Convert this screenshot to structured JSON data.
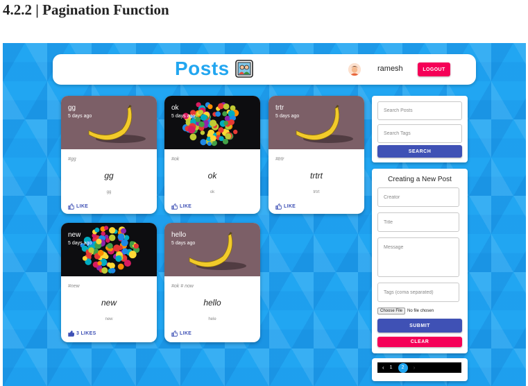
{
  "document": {
    "heading": "4.2.2 | Pagination Function"
  },
  "colors": {
    "brand": "#22a6f0",
    "primary": "#3f51b5",
    "secondary": "#f50057",
    "background": "#21a6f2"
  },
  "header": {
    "title": "Posts",
    "brand_icon": "memories-photo-icon",
    "user": {
      "avatar_icon": "user-avatar-icon",
      "name": "ramesh"
    },
    "logout_label": "LOGOUT"
  },
  "posts": [
    {
      "title": "gg",
      "date": "5 days ago",
      "tags": "#gg",
      "heading": "gg",
      "message": "gg",
      "likes": "LIKE",
      "image": "banana"
    },
    {
      "title": "ok",
      "date": "5 days ago",
      "tags": "#ok",
      "heading": "ok",
      "message": "ok",
      "likes": "LIKE",
      "image": "balls"
    },
    {
      "title": "trtr",
      "date": "5 days ago",
      "tags": "#trtr",
      "heading": "trtrt",
      "message": "trtrt",
      "likes": "LIKE",
      "image": "banana"
    },
    {
      "title": "new",
      "date": "5 days ago",
      "tags": "#new",
      "heading": "new",
      "message": "new",
      "likes": "3 LIKES",
      "image": "balls"
    },
    {
      "title": "hello",
      "date": "5 days ago",
      "tags": "#ok # now",
      "heading": "hello",
      "message": "hele",
      "likes": "LIKE",
      "image": "banana"
    }
  ],
  "search": {
    "posts_placeholder": "Search Posts",
    "tags_placeholder": "Search Tags",
    "button_label": "SEARCH"
  },
  "form": {
    "title": "Creating a New Post",
    "creator_placeholder": "Creator",
    "title_placeholder": "Title",
    "message_placeholder": "Message",
    "tags_placeholder": "Tags (coma separated)",
    "file_button": "Choose File",
    "file_status": "No file chosen",
    "submit_label": "SUBMIT",
    "clear_label": "CLEAR"
  },
  "pagination": {
    "prev": "‹",
    "pages": [
      "1",
      "2"
    ],
    "current": "2",
    "next": "›"
  }
}
